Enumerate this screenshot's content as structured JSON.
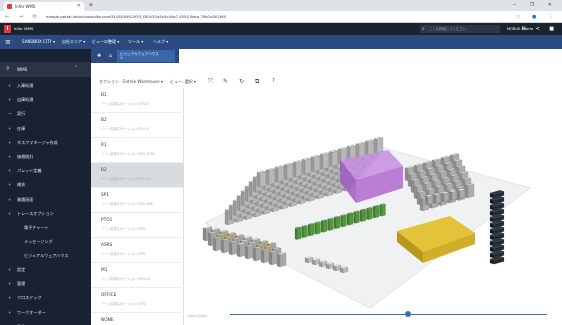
{
  "browser": {
    "tab_title": "Infor WMS",
    "new_tab": "+",
    "url": "mingle-portal.inforcloudsuite.com/ELUSION%2053_DEV/51a5c5c40a7 4550 9bca 79b1a302f94",
    "window_controls": "─ ❐ ✕"
  },
  "app": {
    "title": "Infor WMS",
    "search_placeholder": "ここを検索してください",
    "user": "MORUE Eaorte",
    "top_icons": "✉ ≺ ■"
  },
  "menu": [
    "SANDBOX CITY ▾",
    "自社エリア ▾",
    "ビューの整理 ▾",
    "ツール ▾",
    "ヘルプ ▾"
  ],
  "subtab": {
    "icons": "✚ ⌂",
    "active_label": "ビジュアルウェアハウス",
    "close": "✕"
  },
  "sidebar": {
    "header": "WMS",
    "items": [
      {
        "icon": "+",
        "label": "入庫処理"
      },
      {
        "icon": "+",
        "label": "出庫処理"
      },
      {
        "icon": "—",
        "label": "実行"
      },
      {
        "icon": "+",
        "label": "在庫"
      },
      {
        "icon": "+",
        "label": "タスクマネージャ作成"
      },
      {
        "icon": "+",
        "label": "価格統計"
      },
      {
        "icon": "+",
        "label": "パレット定義"
      },
      {
        "icon": "+",
        "label": "補充"
      },
      {
        "icon": "+",
        "label": "業績画面"
      },
      {
        "icon": "+",
        "label": "トレースオプション"
      }
    ],
    "subitems": [
      "電子チャート",
      "メッセージング",
      "ビジュアルウェアハウス"
    ],
    "items2": [
      {
        "icon": "+",
        "label": "設定"
      },
      {
        "icon": "+",
        "label": "管理"
      },
      {
        "icon": "+",
        "label": "クロスドック"
      },
      {
        "icon": "+",
        "label": "ワークオーダー"
      },
      {
        "icon": "+",
        "label": "予約"
      }
    ]
  },
  "toolbar": {
    "section": "セクション - Entrée Warehouse ▾",
    "view": "ビュー: 選択 ▾",
    "icons": [
      "⤧",
      "✎",
      "↻",
      "⧉",
      "?"
    ]
  },
  "locations": [
    {
      "code": "B1",
      "sub": "ゾーン名前(ロケーション)75% 8"
    },
    {
      "code": "B2",
      "sub": "ゾーン名前(ロケーション)75% 8"
    },
    {
      "code": "R1",
      "sub": "ゾーン名前(ロケーション)75% 1276"
    },
    {
      "code": "R2",
      "sub": "ゾーン名前(ロケーション)75% 40"
    },
    {
      "code": "SP1",
      "sub": "ゾーン名前(ロケーション)75% 166"
    },
    {
      "code": "PTO1",
      "sub": "ゾーン名前(ロケーション)75%"
    },
    {
      "code": "ASRS",
      "sub": "ゾーン名前(ロケーション)75%"
    },
    {
      "code": "M1",
      "sub": "ゾーン名前(ロケーション)75% 40"
    },
    {
      "code": "OFFICE",
      "sub": "ゾーン名前(ロケーション)75%"
    },
    {
      "code": "NONE",
      "sub": "ゾーン名前(ロケーション)75%"
    }
  ],
  "selected_location_index": 3,
  "view3d": {
    "zoom_label": "Zoom/Scale",
    "slider_fraction": 0.56
  },
  "colors": {
    "dark_nav": "#192233",
    "menu_blue": "#2b4a80",
    "accent_red": "#e03a3e",
    "highlight_purple": "#b36ad0",
    "green_rack": "#4f9a3a",
    "yellow_block": "#d4b422"
  }
}
